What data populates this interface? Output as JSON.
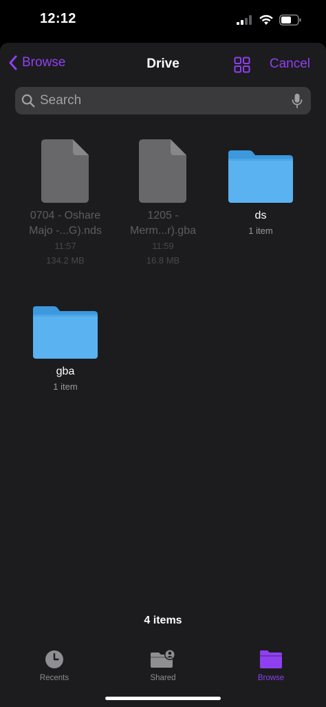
{
  "status_bar": {
    "time": "12:12"
  },
  "nav": {
    "back_label": "Browse",
    "title": "Drive",
    "cancel_label": "Cancel",
    "accent_color": "#8f3ff2"
  },
  "search": {
    "placeholder": "Search",
    "value": ""
  },
  "items": [
    {
      "type": "file",
      "name_line1": "0704 - Oshare",
      "name_line2": "Majo -...G).nds",
      "time": "11:57",
      "size": "134.2 MB",
      "dimmed": true
    },
    {
      "type": "file",
      "name_line1": "1205 -",
      "name_line2": "Merm...r).gba",
      "time": "11:59",
      "size": "16.8 MB",
      "dimmed": true
    },
    {
      "type": "folder",
      "name": "ds",
      "count": "1 item"
    },
    {
      "type": "folder",
      "name": "gba",
      "count": "1 item"
    }
  ],
  "footer": {
    "items_count": "4 items"
  },
  "tabs": [
    {
      "label": "Recents",
      "icon": "clock-icon",
      "active": false
    },
    {
      "label": "Shared",
      "icon": "shared-folder-icon",
      "active": false
    },
    {
      "label": "Browse",
      "icon": "folder-icon",
      "active": true
    }
  ],
  "colors": {
    "folder_blue": "#5ab3f0",
    "file_gray": "#68686b",
    "background": "#1c1c1e"
  }
}
